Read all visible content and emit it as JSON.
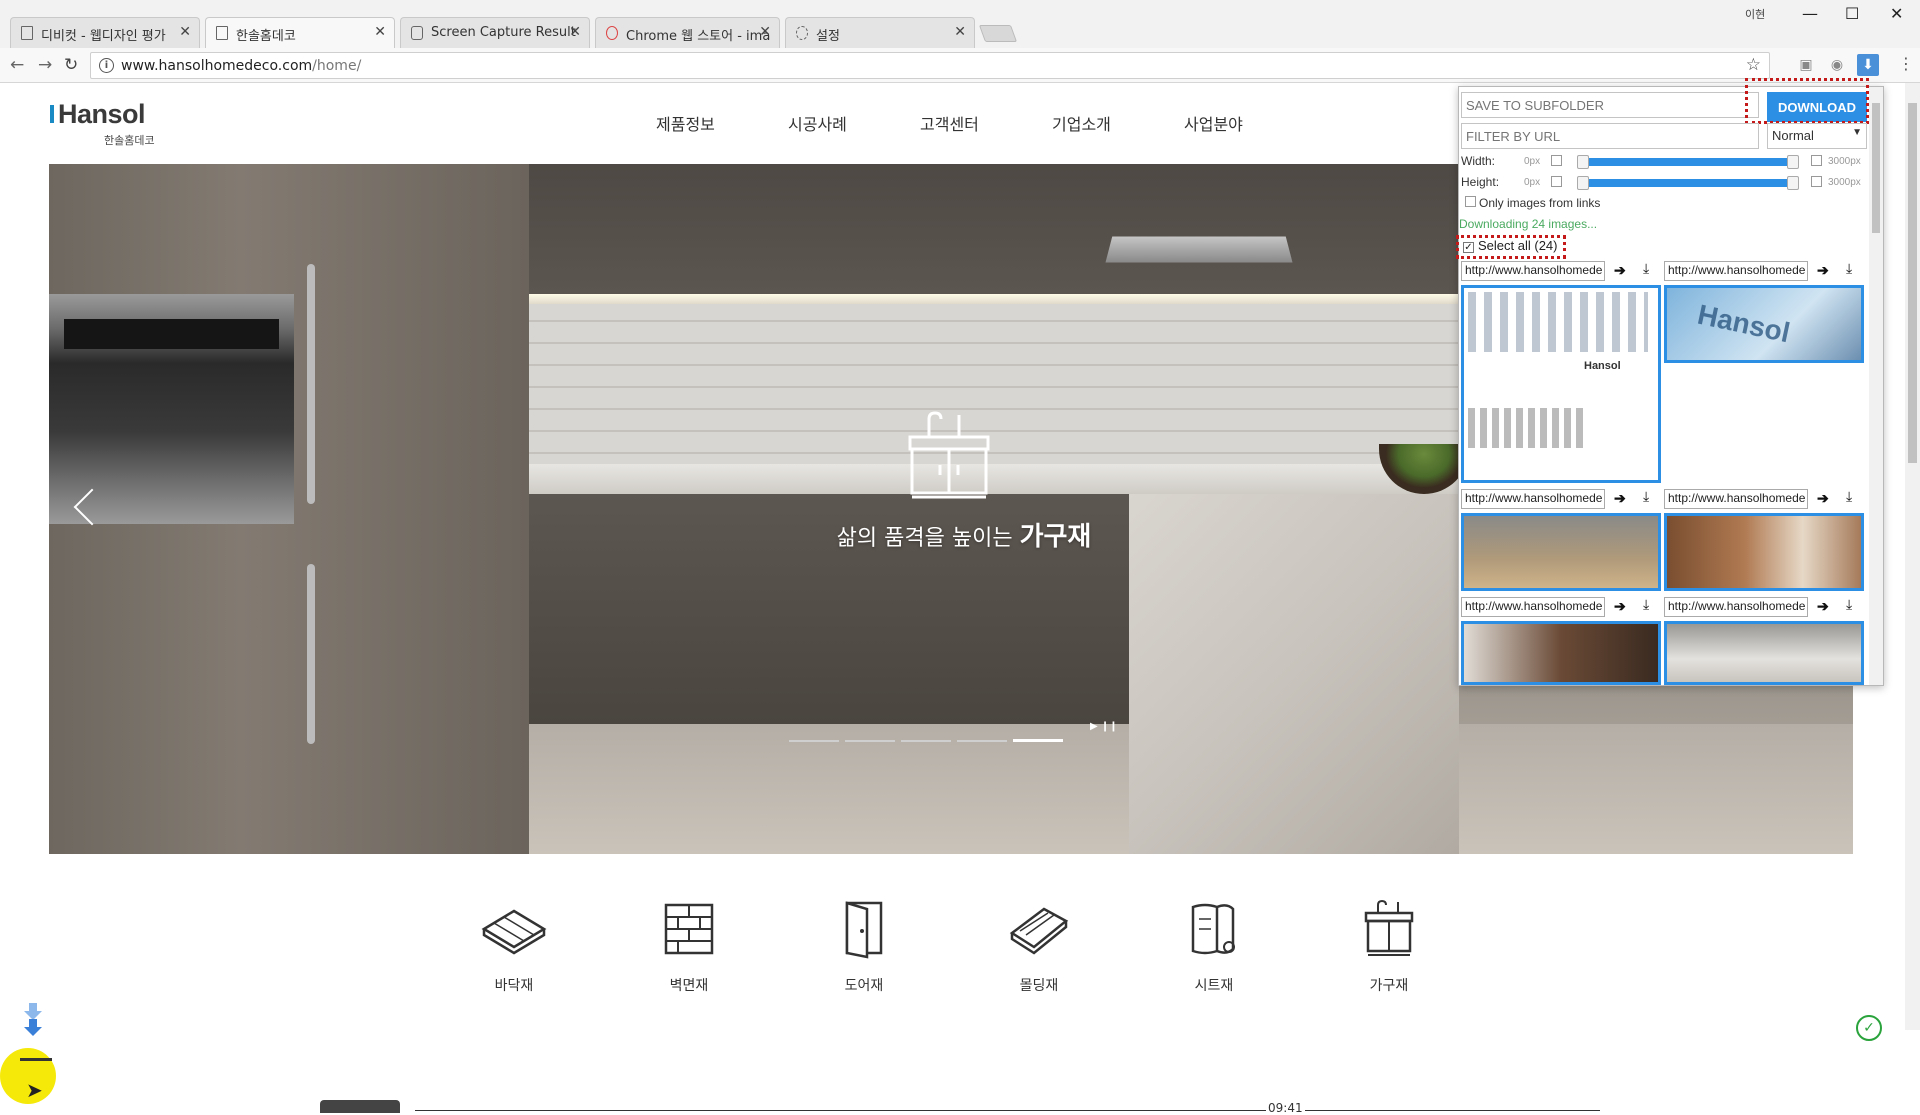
{
  "browser": {
    "tabs": [
      {
        "title": "디비컷 - 웹디자인 평가",
        "active": false
      },
      {
        "title": "한솔홈데코",
        "active": true
      },
      {
        "title": "Screen Capture Result",
        "active": false
      },
      {
        "title": "Chrome 웹 스토어 - ima",
        "active": false
      },
      {
        "title": "설정",
        "active": false
      }
    ],
    "profile_label": "이현",
    "url_host": "www.hansolhomedeco.com",
    "url_path": "/home/"
  },
  "site": {
    "logo_text": "Hansol",
    "logo_sub": "한솔홈데코",
    "nav": [
      "제품정보",
      "시공사례",
      "고객센터",
      "기업소개",
      "사업분야"
    ],
    "hero": {
      "caption_plain": "삶의 품격을 높이는",
      "caption_bold": "가구재",
      "slide_count": 5,
      "active_slide": 5
    },
    "categories": [
      {
        "label": "바닥재",
        "icon": "floor-icon"
      },
      {
        "label": "벽면재",
        "icon": "wall-icon"
      },
      {
        "label": "도어재",
        "icon": "door-icon"
      },
      {
        "label": "몰딩재",
        "icon": "molding-icon"
      },
      {
        "label": "시트재",
        "icon": "sheet-icon"
      },
      {
        "label": "가구재",
        "icon": "furniture-icon"
      }
    ],
    "timestamp": "09:41"
  },
  "downloader": {
    "subfolder_placeholder": "SAVE TO SUBFOLDER",
    "download_label": "DOWNLOAD",
    "filter_placeholder": "FILTER BY URL",
    "filter_mode": "Normal",
    "width_label": "Width:",
    "height_label": "Height:",
    "min_px": "0px",
    "max_px": "3000px",
    "only_links_label": "Only images from links",
    "status_text": "Downloading 24 images...",
    "select_all_label": "Select all (24)",
    "image_url_prefix": "http://www.hansolhomede",
    "accent": "#2c8fe3"
  }
}
